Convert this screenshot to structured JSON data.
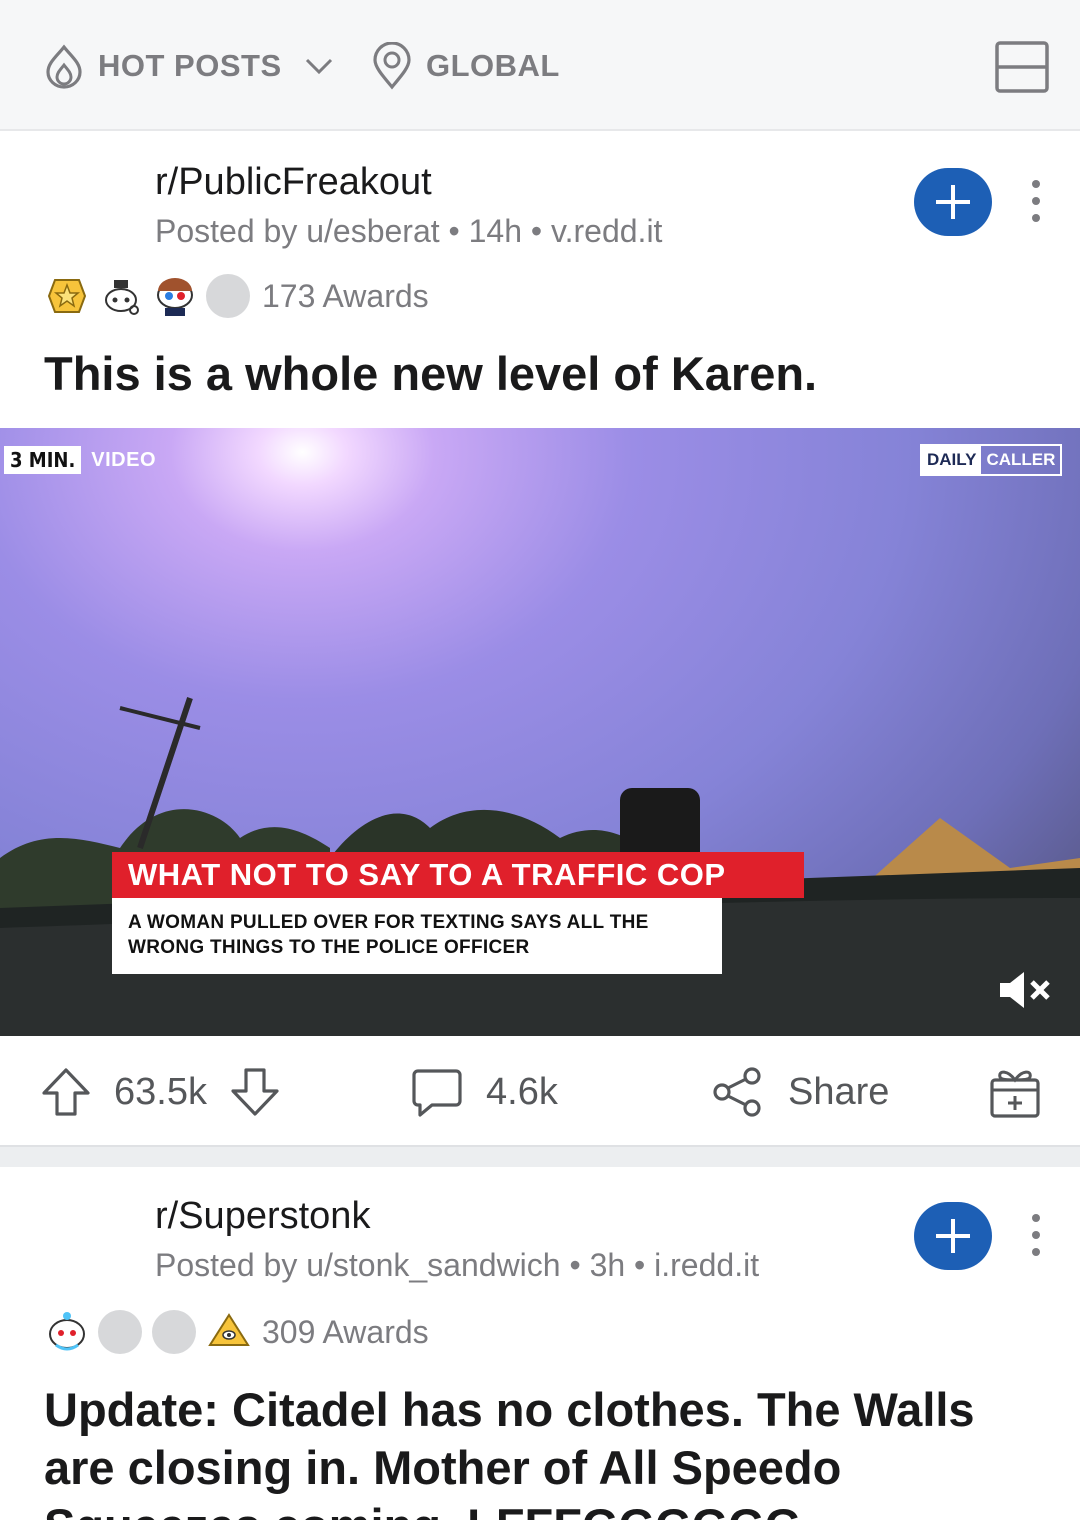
{
  "topbar": {
    "sort_label": "HOT POSTS",
    "location_label": "GLOBAL",
    "icons": {
      "sort": "flame-icon",
      "location": "location-pin-icon",
      "dropdown": "chevron-down-icon",
      "layout": "card-layout-icon"
    }
  },
  "posts": [
    {
      "subreddit": "r/PublicFreakout",
      "posted_by": "Posted by u/esberat",
      "age": "14h",
      "domain": "v.redd.it",
      "meta_separator": "•",
      "awards_count": "173 Awards",
      "title": "This is a whole new level of Karen.",
      "video": {
        "duration_badge": "3 MIN.",
        "type_badge": "VIDEO",
        "brand_part1": "DAILY",
        "brand_part2": "CALLER",
        "headline": "WHAT NOT TO SAY TO A TRAFFIC COP",
        "subheadline": "A WOMAN PULLED OVER FOR TEXTING SAYS ALL THE WRONG THINGS TO THE POLICE OFFICER",
        "muted": true
      },
      "upvotes": "63.5k",
      "comments": "4.6k",
      "share_label": "Share"
    },
    {
      "subreddit": "r/Superstonk",
      "posted_by": "Posted by u/stonk_sandwich",
      "age": "3h",
      "domain": "i.redd.it",
      "meta_separator": "•",
      "awards_count": "309 Awards",
      "title": "Update: Citadel has no clothes. The Walls are closing in. Mother of All Speedo Squeezes coming. LFFFGGGGGG"
    }
  ],
  "colors": {
    "accent_blue": "#1d5fb5",
    "muted_text": "#7c7c80",
    "headline_red": "#e0202b"
  }
}
